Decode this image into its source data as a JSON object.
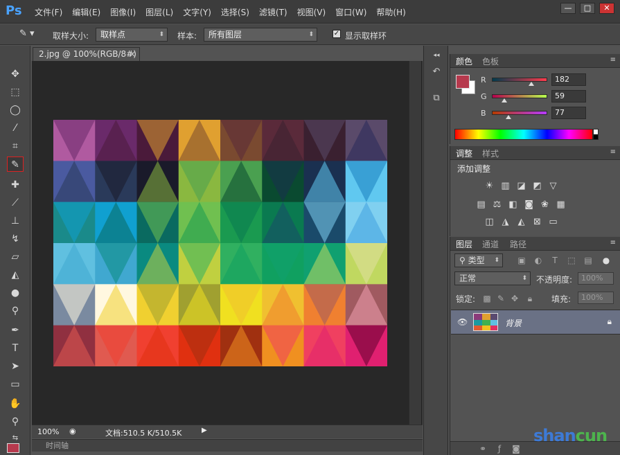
{
  "app": {
    "logo": "Ps",
    "menu": [
      "文件(F)",
      "编辑(E)",
      "图像(I)",
      "图层(L)",
      "文字(Y)",
      "选择(S)",
      "滤镜(T)",
      "视图(V)",
      "窗口(W)",
      "帮助(H)"
    ],
    "window_controls": [
      "—",
      "□",
      "✕"
    ]
  },
  "options": {
    "sample_size_label": "取样大小:",
    "sample_size_value": "取样点",
    "sample_label": "样本:",
    "sample_value": "所有图层",
    "show_ring_label": "显示取样环",
    "show_ring_checked": true
  },
  "document": {
    "tab_title": "2.jpg @ 100%(RGB/8#)",
    "tab_close": "×",
    "zoom": "100%",
    "doc_info": "文档:510.5 K/510.5K",
    "timeline_label": "时间轴"
  },
  "color_panel": {
    "tabs": [
      "颜色",
      "色板"
    ],
    "foreground": "#b6394d",
    "channels": [
      {
        "label": "R",
        "value": "182",
        "fraction": 0.71
      },
      {
        "label": "G",
        "value": "59",
        "fraction": 0.23
      },
      {
        "label": "B",
        "value": "77",
        "fraction": 0.3
      }
    ]
  },
  "adjust_panel": {
    "tabs": [
      "调整",
      "样式"
    ],
    "title": "添加调整",
    "row1_icons": [
      "brightness-icon",
      "levels-icon",
      "curves-icon",
      "exposure-icon",
      "vibrance-icon"
    ],
    "row2_icons": [
      "hue-sat-icon",
      "color-balance-icon",
      "black-white-icon",
      "photo-filter-icon",
      "channel-mixer-icon",
      "color-lookup-icon"
    ],
    "row3_icons": [
      "invert-icon",
      "posterize-icon",
      "threshold-icon",
      "selective-color-icon",
      "gradient-map-icon"
    ]
  },
  "layers_panel": {
    "tabs": [
      "图层",
      "通道",
      "路径"
    ],
    "filter_label": "类型",
    "blend_mode": "正常",
    "opacity_label": "不透明度:",
    "opacity_value": "100%",
    "lock_label": "锁定:",
    "fill_label": "填充:",
    "fill_value": "100%",
    "layer_name": "背景"
  },
  "colors": {
    "foreground": "#b6394d",
    "layer_selected": "#6a7185"
  },
  "watermark": {
    "text_a": "shan",
    "text_b": "cun"
  }
}
